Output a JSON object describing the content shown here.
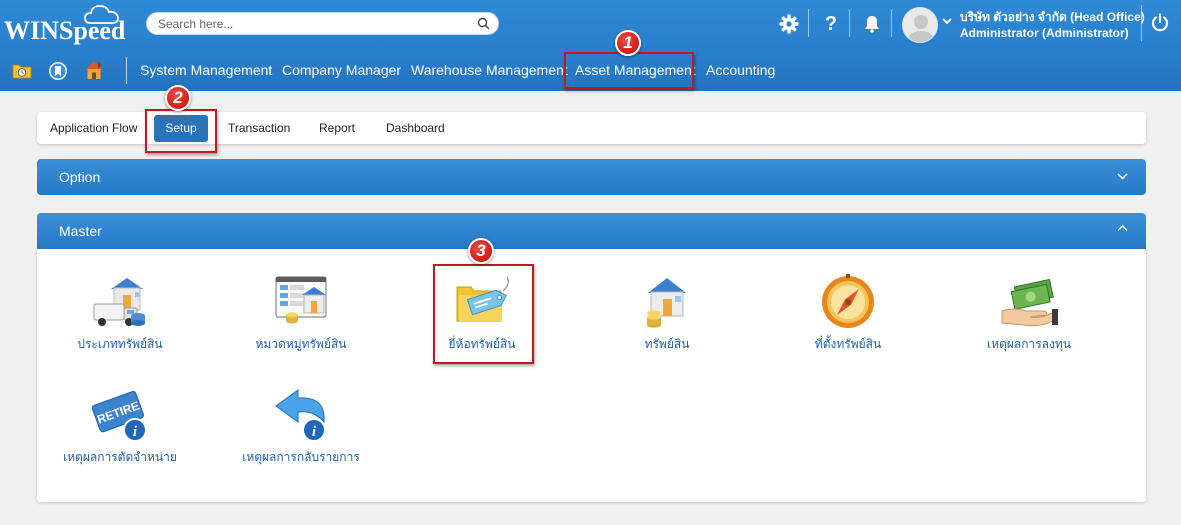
{
  "app": {
    "logo": "WINSpeed"
  },
  "search": {
    "placeholder": "Search here..."
  },
  "header": {
    "company": "บริษัท ตัวอย่าง จำกัด (Head Office)",
    "user": "Administrator (Administrator)"
  },
  "menu": [
    {
      "label": "System Management"
    },
    {
      "label": "Company Manager"
    },
    {
      "label": "Warehouse Management"
    },
    {
      "label": "Asset Management"
    },
    {
      "label": "Accounting"
    }
  ],
  "tabs": [
    {
      "label": "Application Flow"
    },
    {
      "label": "Setup",
      "active": true
    },
    {
      "label": "Transaction"
    },
    {
      "label": "Report"
    },
    {
      "label": "Dashboard"
    }
  ],
  "panels": {
    "option": {
      "title": "Option",
      "expanded": false
    },
    "master": {
      "title": "Master",
      "expanded": true
    }
  },
  "master_items": [
    {
      "label": "ประเภททรัพย์สิน",
      "icon": "asset-type-icon"
    },
    {
      "label": "หมวดหมู่ทรัพย์สิน",
      "icon": "asset-category-icon"
    },
    {
      "label": "ยี่ห้อทรัพย์สิน",
      "icon": "asset-brand-icon"
    },
    {
      "label": "ทรัพย์สิน",
      "icon": "asset-icon"
    },
    {
      "label": "ที่ตั้งทรัพย์สิน",
      "icon": "asset-location-icon"
    },
    {
      "label": "เหตุผลการลงทุน",
      "icon": "investment-reason-icon"
    },
    {
      "label": "เหตุผลการตัดจำหน่าย",
      "icon": "retire-reason-icon"
    },
    {
      "label": "เหตุผลการกลับรายการ",
      "icon": "reverse-reason-icon"
    }
  ],
  "annotations": [
    "1",
    "2",
    "3"
  ],
  "colors": {
    "header": "#2a7fcc",
    "highlight": "#c0191f",
    "badge": "#d8261f",
    "link": "#1f5fa5"
  }
}
